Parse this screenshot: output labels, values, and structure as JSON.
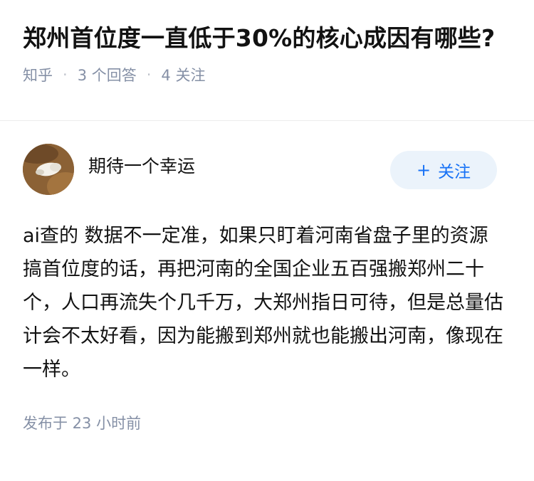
{
  "question": {
    "title": "郑州首位度一直低于30%的核心成因有哪些?",
    "source": "知乎",
    "answers_count": "3 个回答",
    "followers_count": "4 关注"
  },
  "answer": {
    "author": "期待一个幸运",
    "follow_label": "关注",
    "follow_icon": "+",
    "content": "ai查的 数据不一定准，如果只盯着河南省盘子里的资源搞首位度的话，再把河南的全国企业五百强搬郑州二十个，人口再流失个几千万，大郑州指日可待，但是总量估计会不太好看，因为能搬到郑州就也能搬出河南，像现在一样。",
    "time": "发布于 23 小时前"
  },
  "colors": {
    "accent": "#1772f6",
    "follow_bg": "#ebf3fb",
    "meta": "#8590a6"
  }
}
